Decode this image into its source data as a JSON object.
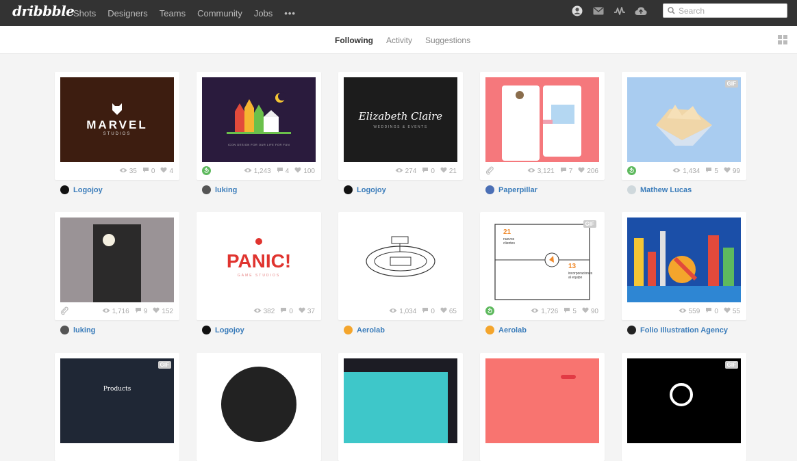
{
  "nav": {
    "logo": "dribbble",
    "links": [
      "Shots",
      "Designers",
      "Teams",
      "Community",
      "Jobs"
    ],
    "more": "•••",
    "icons": [
      "avatar-icon",
      "mail-icon",
      "activity-icon",
      "upload-icon"
    ],
    "search_placeholder": "Search"
  },
  "subnav": {
    "tabs": [
      "Following",
      "Activity",
      "Suggestions"
    ],
    "active_tab": "Following"
  },
  "shots": [
    {
      "views": "35",
      "comments": "0",
      "likes": "4",
      "author": "Logojoy",
      "badge": "",
      "gif": false,
      "thumb_text": "MARVEL",
      "thumb_sub": "STUDIOS"
    },
    {
      "views": "1,243",
      "comments": "4",
      "likes": "100",
      "author": "luking",
      "badge": "rebound",
      "gif": false,
      "thumb_text": "ICON DESIGN FOR OUR LIFE FOR FUN",
      "thumb_sub": ""
    },
    {
      "views": "274",
      "comments": "0",
      "likes": "21",
      "author": "Logojoy",
      "badge": "",
      "gif": false,
      "thumb_text": "Elizabeth Claire",
      "thumb_sub": "WEDDINGS & EVENTS"
    },
    {
      "views": "3,121",
      "comments": "7",
      "likes": "206",
      "author": "Paperpillar",
      "badge": "attachment",
      "gif": false,
      "thumb_text": "",
      "thumb_sub": ""
    },
    {
      "views": "1,434",
      "comments": "5",
      "likes": "99",
      "author": "Mathew Lucas",
      "badge": "rebound",
      "gif": true,
      "thumb_text": "",
      "thumb_sub": ""
    },
    {
      "views": "1,716",
      "comments": "9",
      "likes": "152",
      "author": "luking",
      "badge": "attachment",
      "gif": false,
      "thumb_text": "",
      "thumb_sub": ""
    },
    {
      "views": "382",
      "comments": "0",
      "likes": "37",
      "author": "Logojoy",
      "badge": "",
      "gif": false,
      "thumb_text": "PANIC!",
      "thumb_sub": "GAME STUDIOS"
    },
    {
      "views": "1,034",
      "comments": "0",
      "likes": "65",
      "author": "Aerolab",
      "badge": "",
      "gif": false,
      "thumb_text": "",
      "thumb_sub": ""
    },
    {
      "views": "1,726",
      "comments": "5",
      "likes": "90",
      "author": "Aerolab",
      "badge": "rebound",
      "gif": true,
      "thumb_text": "21",
      "thumb_sub": "nuevos clientes",
      "thumb_text2": "13",
      "thumb_sub2": "incorporaciones al equipo"
    },
    {
      "views": "559",
      "comments": "0",
      "likes": "55",
      "author": "Folio Illustration Agency",
      "badge": "",
      "gif": false,
      "thumb_text": "",
      "thumb_sub": ""
    },
    {
      "views": "",
      "comments": "",
      "likes": "",
      "author": "",
      "badge": "",
      "gif": true,
      "thumb_text": "Products",
      "thumb_sub": ""
    },
    {
      "views": "",
      "comments": "",
      "likes": "",
      "author": "",
      "badge": "",
      "gif": false,
      "thumb_text": "",
      "thumb_sub": ""
    },
    {
      "views": "",
      "comments": "",
      "likes": "",
      "author": "",
      "badge": "",
      "gif": false,
      "thumb_text": "",
      "thumb_sub": ""
    },
    {
      "views": "",
      "comments": "",
      "likes": "",
      "author": "",
      "badge": "",
      "gif": false,
      "thumb_text": "",
      "thumb_sub": ""
    },
    {
      "views": "",
      "comments": "",
      "likes": "",
      "author": "",
      "badge": "",
      "gif": true,
      "thumb_text": "",
      "thumb_sub": ""
    }
  ],
  "gif_label": "GIF",
  "colors": {
    "nav_bg": "#333333",
    "link": "#3a7cba",
    "rebound_green": "#5eb95e"
  }
}
